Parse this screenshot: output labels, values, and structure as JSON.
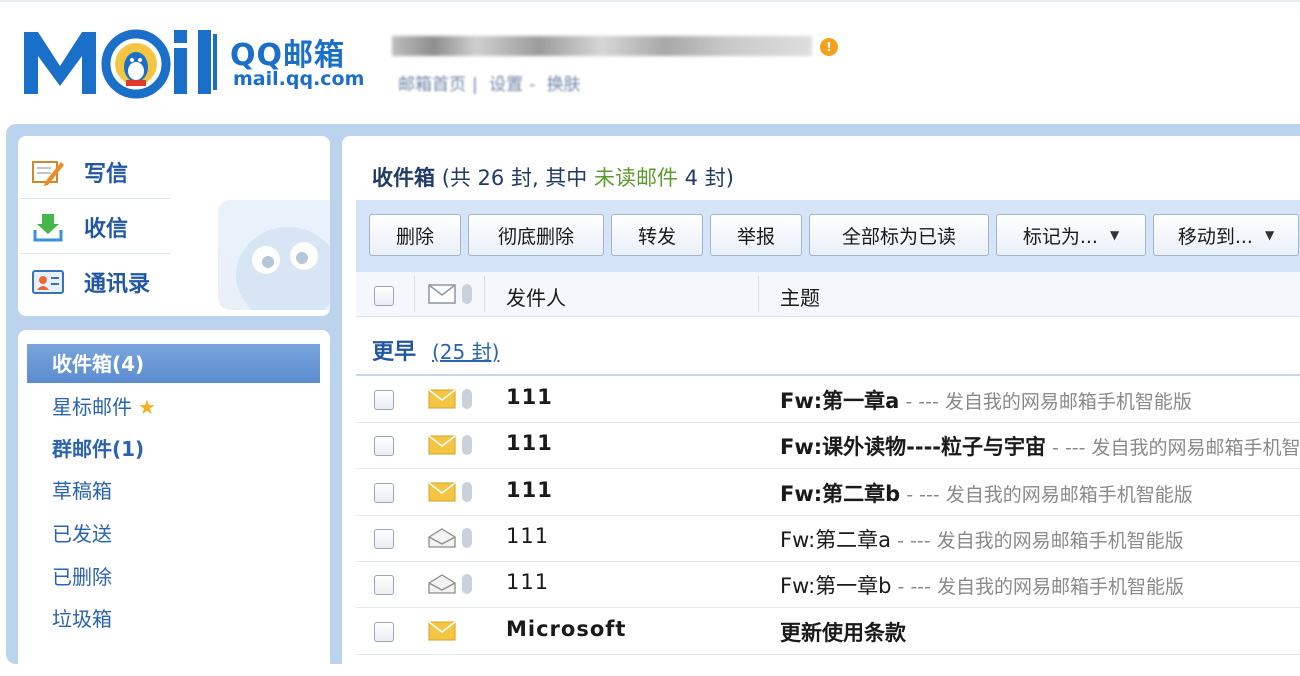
{
  "header": {
    "logo_word": "MOil",
    "logo_product": "QQ邮箱",
    "logo_domain": "mail.qq.com",
    "warning_badge": "!",
    "links": [
      "邮箱首页",
      "设置",
      "换肤"
    ]
  },
  "quick_actions": [
    {
      "label": "写信",
      "icon": "compose-icon"
    },
    {
      "label": "收信",
      "icon": "receive-icon"
    },
    {
      "label": "通讯录",
      "icon": "contacts-icon"
    }
  ],
  "folders": {
    "active": "收件箱(4)",
    "items": [
      {
        "label": "星标邮件",
        "star": "★"
      },
      {
        "label": "群邮件(1)",
        "bold": true
      },
      {
        "label": "草稿箱"
      },
      {
        "label": "已发送"
      },
      {
        "label": "已删除"
      },
      {
        "label": "垃圾箱"
      }
    ]
  },
  "inbox": {
    "title": "收件箱",
    "summary_prefix": "(共 26 封, 其中 ",
    "unread_label": "未读邮件",
    "summary_suffix": " 4 封)"
  },
  "toolbar": {
    "delete": "删除",
    "perm_delete": "彻底删除",
    "forward": "转发",
    "report": "举报",
    "mark_all_read": "全部标为已读",
    "mark_as": "标记为...",
    "move_to": "移动到...",
    "caret": "▼"
  },
  "columns": {
    "sender": "发件人",
    "subject": "主题"
  },
  "group": {
    "label": "更早",
    "count": "(25 封)"
  },
  "mails": [
    {
      "sender": "111",
      "subject": "Fw:第一章a",
      "preview": " -  --- 发自我的网易邮箱手机智能版",
      "unread": true
    },
    {
      "sender": "111",
      "subject": "Fw:课外读物----粒子与宇宙",
      "preview": " -  --- 发自我的网易邮箱手机智能版",
      "unread": true
    },
    {
      "sender": "111",
      "subject": "Fw:第二章b",
      "preview": " -  --- 发自我的网易邮箱手机智能版",
      "unread": true
    },
    {
      "sender": "111",
      "subject": "Fw:第二章a",
      "preview": " -  --- 发自我的网易邮箱手机智能版",
      "unread": false
    },
    {
      "sender": "111",
      "subject": "Fw:第一章b",
      "preview": " -  --- 发自我的网易邮箱手机智能版",
      "unread": false
    },
    {
      "sender": "Microsoft",
      "subject": "更新使用条款",
      "preview": "",
      "unread": true
    }
  ],
  "colors": {
    "brand_blue": "#1a6fc9",
    "frame_blue": "#bcd3ee",
    "unread_green": "#5d9b2d",
    "envelope_yellow": "#f4c542"
  }
}
